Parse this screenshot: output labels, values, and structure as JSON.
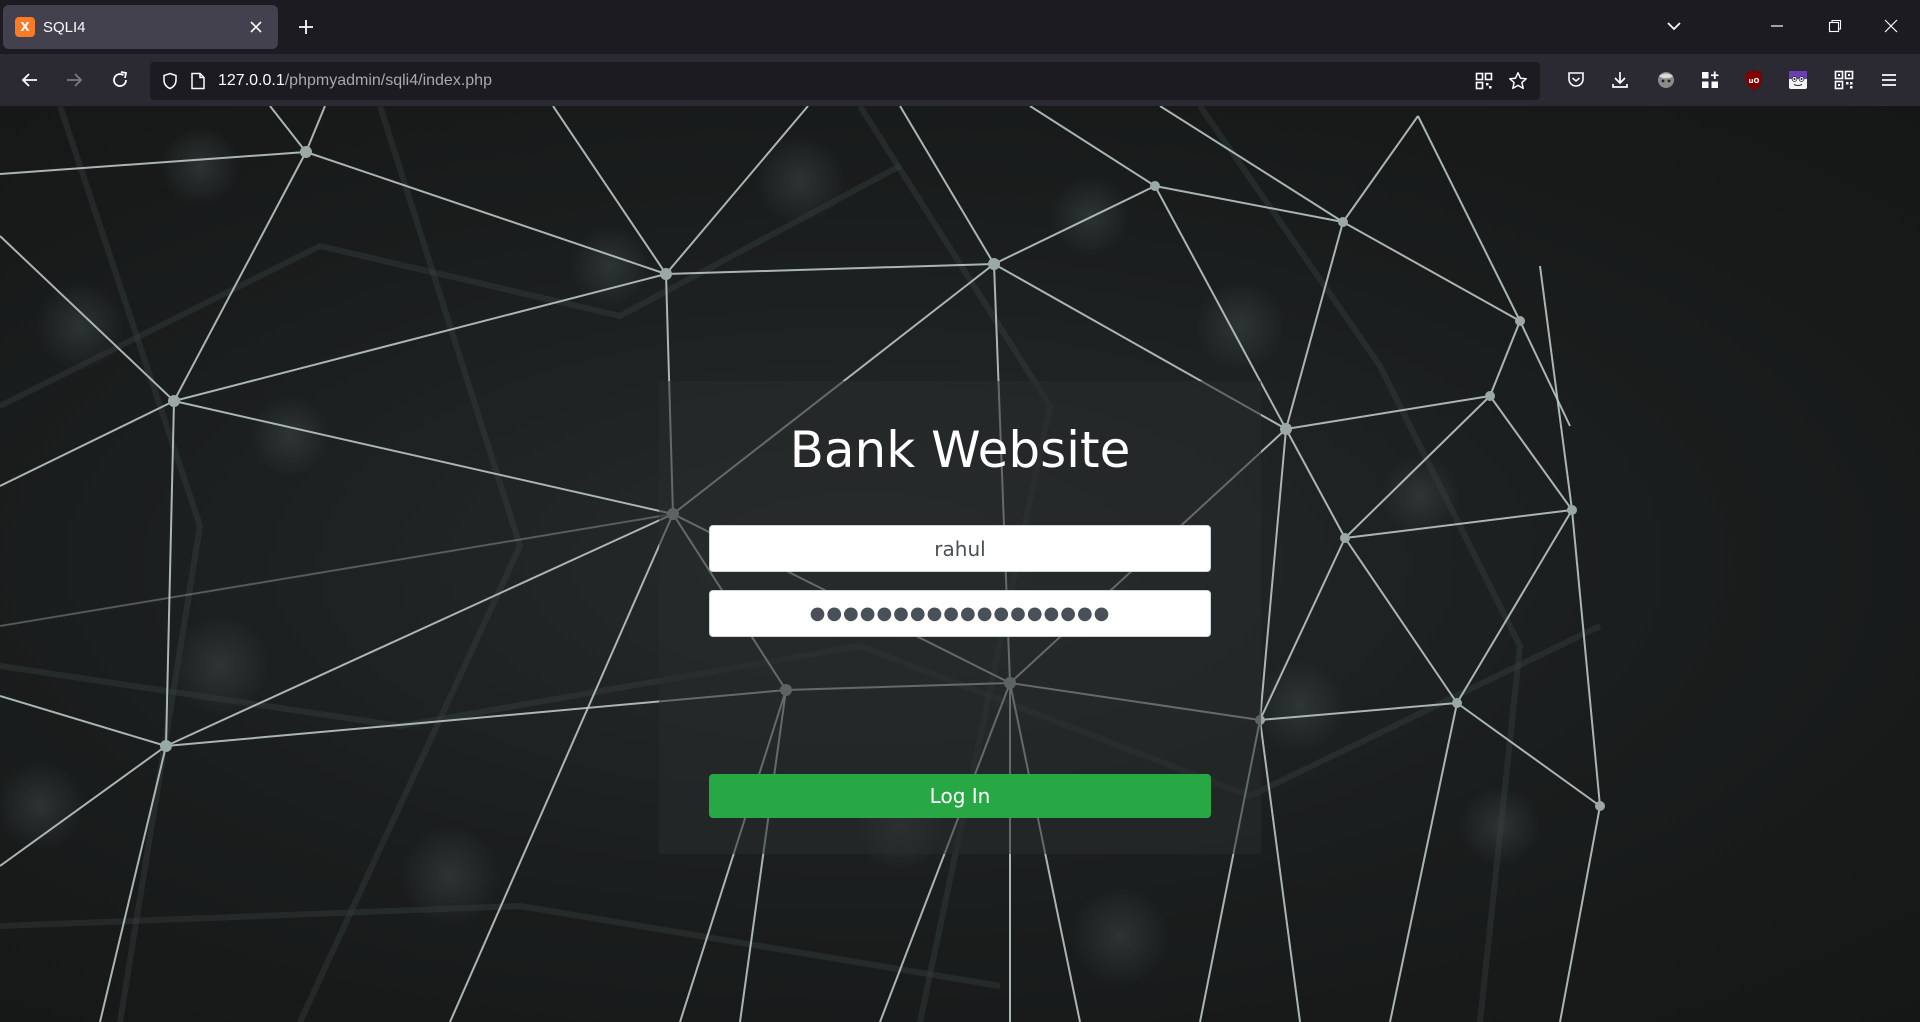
{
  "browser": {
    "tab": {
      "favicon_text": "X",
      "title": "SQLI4"
    },
    "url": {
      "host": "127.0.0.1",
      "path": "/phpmyadmin/sqli4/index.php"
    }
  },
  "login": {
    "title": "Bank Website",
    "username_value": "rahul",
    "password_value": "●●●●●●●●●●●●●●●●●●",
    "submit_label": "Log In"
  },
  "colors": {
    "button_green": "#28a745",
    "tab_active": "#42414d",
    "toolbar": "#2b2a33"
  }
}
